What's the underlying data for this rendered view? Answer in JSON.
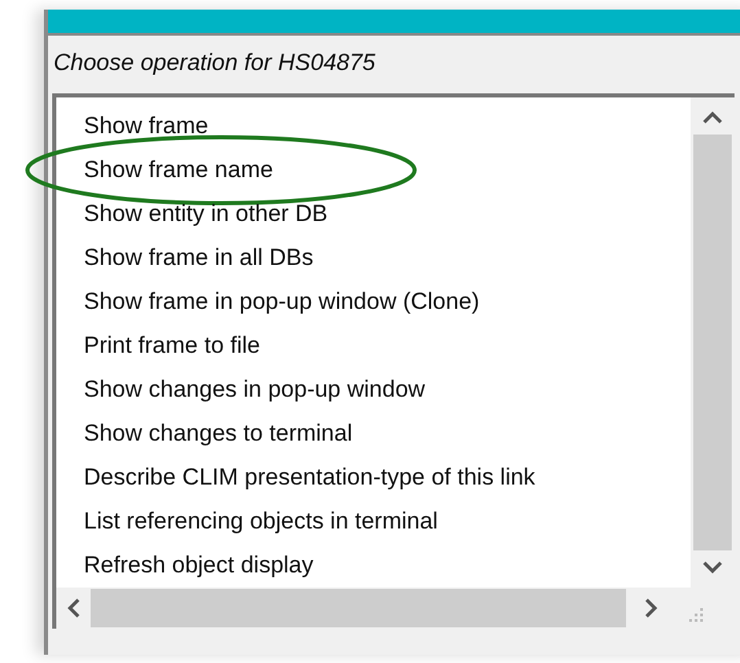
{
  "prompt": "Choose operation for HS04875",
  "items": [
    {
      "label": "Show frame",
      "circled": false
    },
    {
      "label": "Show frame name",
      "circled": true
    },
    {
      "label": "Show entity in other DB",
      "circled": false
    },
    {
      "label": "Show frame in all DBs",
      "circled": false
    },
    {
      "label": "Show frame in pop-up window (Clone)",
      "circled": false
    },
    {
      "label": "Print frame to file",
      "circled": false
    },
    {
      "label": "Show changes in pop-up window",
      "circled": false
    },
    {
      "label": "Show changes to terminal",
      "circled": false
    },
    {
      "label": "Describe CLIM presentation-type of this link",
      "circled": false
    },
    {
      "label": "List referencing objects in terminal",
      "circled": false
    },
    {
      "label": "Refresh object display",
      "circled": false
    }
  ]
}
